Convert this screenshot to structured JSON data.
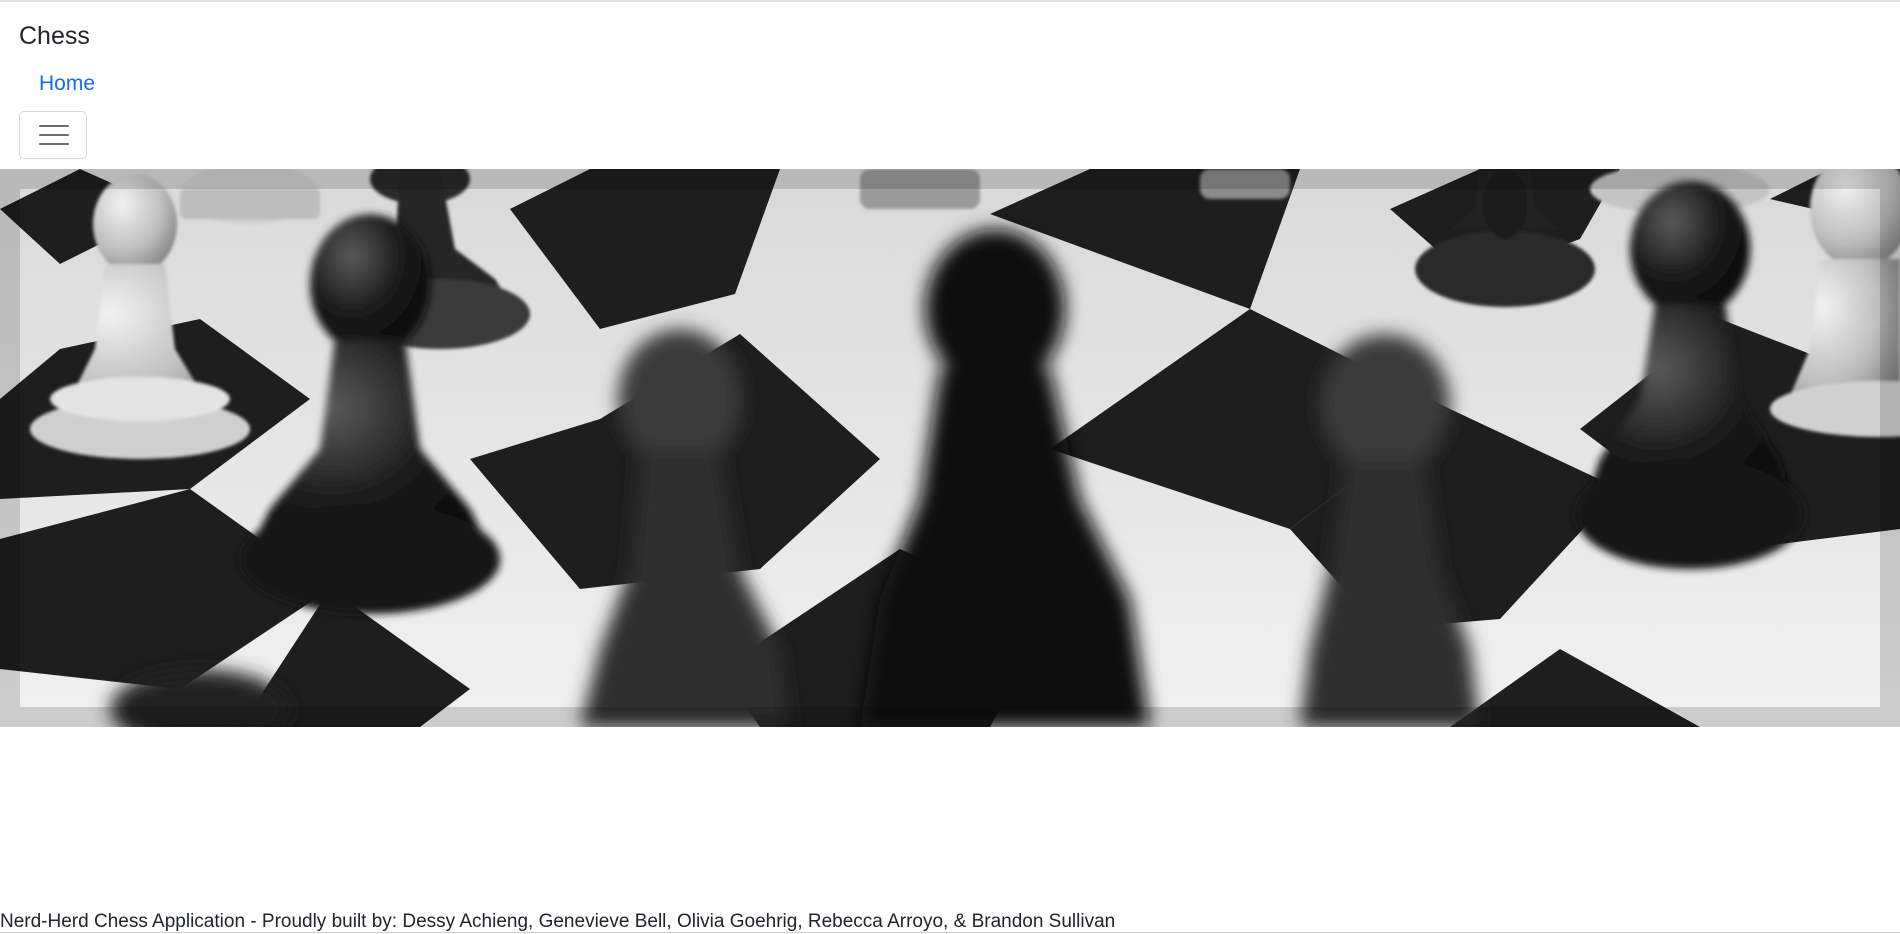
{
  "navbar": {
    "brand": "Chess",
    "links": [
      {
        "label": "Home"
      }
    ],
    "toggler_icon": "hamburger-menu-icon"
  },
  "hero": {
    "image": "chess-board-photo",
    "tone": "grayscale"
  },
  "footer": {
    "text": "Nerd-Herd Chess Application - Proudly built by: Dessy Achieng, Genevieve Bell, Olivia Goehrig, Rebecca Arroyo, & Brandon Sullivan"
  },
  "colors": {
    "link": "#0d6efd",
    "text": "#212529",
    "toggler_border": "#d7d7d7"
  }
}
